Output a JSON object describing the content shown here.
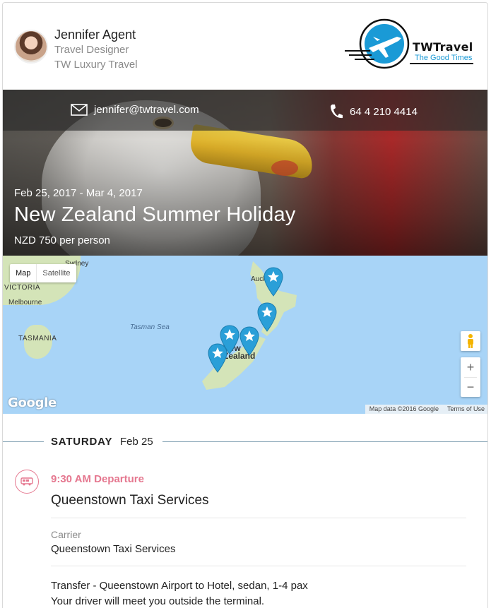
{
  "agent": {
    "name": "Jennifer Agent",
    "role": "Travel Designer",
    "company": "TW Luxury Travel"
  },
  "logo": {
    "brand": "TWTravel",
    "tagline": "The Good Times",
    "accent": "#1a9ad6"
  },
  "contact": {
    "email": "jennifer@twtravel.com",
    "phone": "64 4 210 4414"
  },
  "trip": {
    "dates": "Feb 25, 2017 - Mar 4, 2017",
    "title": "New Zealand Summer Holiday",
    "price": "NZD 750 per person"
  },
  "map": {
    "type_active": "Map",
    "type_other": "Satellite",
    "labels": {
      "sydney": "Sydney",
      "victoria": "VICTORIA",
      "melbourne": "Melbourne",
      "tasmania": "TASMANIA",
      "tasman_sea": "Tasman Sea",
      "auckland": "Auckland",
      "new_zealand": "New Zealand"
    },
    "provider": "Google",
    "attribution": "Map data ©2016 Google",
    "terms": "Terms of Use",
    "zoom_in": "+",
    "zoom_out": "−",
    "pin_color": "#2a9fd8"
  },
  "itinerary": {
    "day_name": "SATURDAY",
    "day_date": "Feb 25",
    "segment": {
      "icon": "bus-icon",
      "accent": "#e5778f",
      "time": "9:30 AM Departure",
      "title": "Queenstown Taxi Services",
      "carrier_label": "Carrier",
      "carrier_value": "Queenstown Taxi Services",
      "description": "Transfer - Queenstown Airport to Hotel, sedan, 1-4 pax",
      "note": "Your driver will meet you outside the terminal."
    }
  }
}
